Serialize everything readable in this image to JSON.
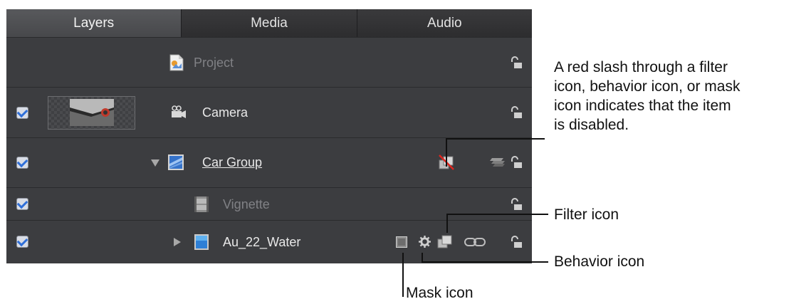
{
  "tabs": [
    {
      "label": "Layers",
      "active": true
    },
    {
      "label": "Media",
      "active": false
    },
    {
      "label": "Audio",
      "active": false
    }
  ],
  "layers": [
    {
      "name": "Project",
      "icon": "project-icon",
      "checked": false,
      "enabled": false
    },
    {
      "name": "Camera",
      "icon": "camera-icon",
      "checked": true,
      "enabled": true
    },
    {
      "name": "Car Group",
      "icon": "group-icon",
      "checked": true,
      "enabled": true,
      "expanded": true
    },
    {
      "name": "Vignette",
      "icon": "filter-icon",
      "checked": true,
      "enabled": false
    },
    {
      "name": "Au_22_Water",
      "icon": "image-layer-icon",
      "checked": true,
      "enabled": true,
      "expanded": false
    }
  ],
  "annotations": {
    "disabled_text": [
      "A red slash through a filter",
      "icon, behavior icon, or mask",
      "icon indicates that the item",
      "is disabled."
    ],
    "filter_icon": "Filter icon",
    "behavior_icon": "Behavior icon",
    "mask_icon": "Mask icon"
  }
}
